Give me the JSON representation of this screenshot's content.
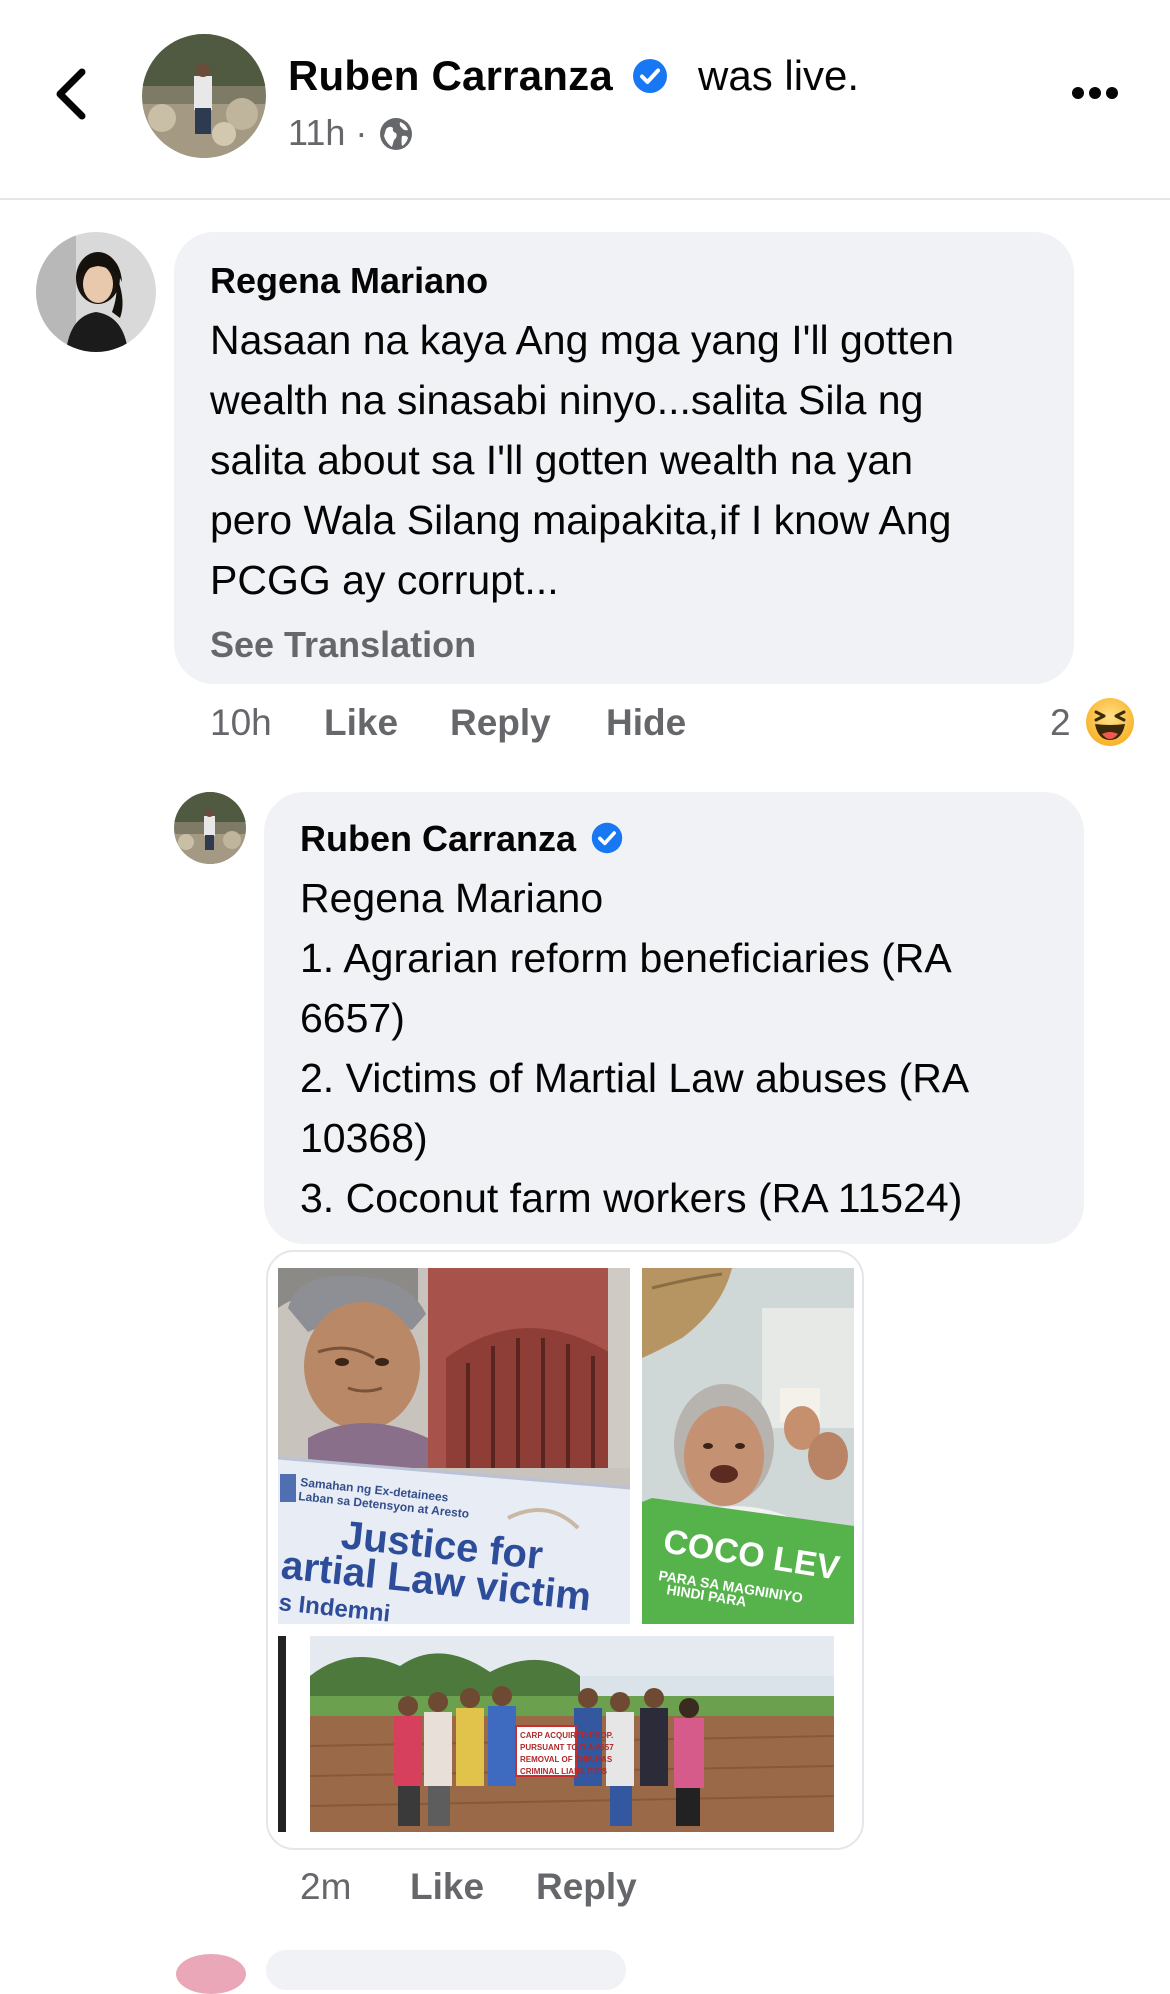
{
  "header": {
    "author": "Ruben Carranza",
    "status": "was live.",
    "time": "11h ·",
    "icons": {
      "back": "chevron-left-icon",
      "audience": "globe-icon",
      "more": "more-options-icon",
      "verified": "verified-badge-icon"
    }
  },
  "comment1": {
    "name": "Regena Mariano",
    "lines": [
      "Nasaan na kaya Ang mga yang I'll gotten",
      "wealth na sinasabi ninyo...salita Sila ng",
      "salita about sa I'll gotten wealth na yan",
      "pero Wala Silang maipakita,if I know Ang",
      "PCGG ay corrupt..."
    ],
    "see_translation": "See Translation",
    "time": "10h",
    "like": "Like",
    "reply": "Reply",
    "hide": "Hide",
    "reaction_count": "2",
    "reaction_icon": "haha-emoji-icon"
  },
  "reply1": {
    "name": "Ruben Carranza",
    "lines": [
      "Regena Mariano",
      "1. Agrarian reform beneficiaries (RA",
      "6657)",
      "2. Victims of Martial Law abuses (RA",
      "10368)",
      "3. Coconut farm workers (RA 11524)"
    ],
    "photos": {
      "p1_org_line1": "Samahan ng Ex-detainees",
      "p1_org_line2": "Laban sa Detensyon at Aresto",
      "p1_banner_line1": "Justice for",
      "p1_banner_line2": "artial Law victim",
      "p1_banner_line3": "s Indemni",
      "p2_sign_line1": "COCO LEV",
      "p2_sign_line2": "PARA SA MAGNINIYO",
      "p2_sign_line3": "HINDI PARA",
      "p3_sign_line1": "CARP ACQUIRED PROP.",
      "p3_sign_line2": "PURSUANT TO R.A.6657",
      "p3_sign_line3": "REMOVAL OF THIS HAS",
      "p3_sign_line4": "CRIMINAL LIABILITIES"
    },
    "time": "2m",
    "like": "Like",
    "reply": "Reply"
  },
  "colors": {
    "text": "#050505",
    "secondary": "#65676b",
    "bubble": "#f0f2f5",
    "verified": "#1877f2"
  }
}
